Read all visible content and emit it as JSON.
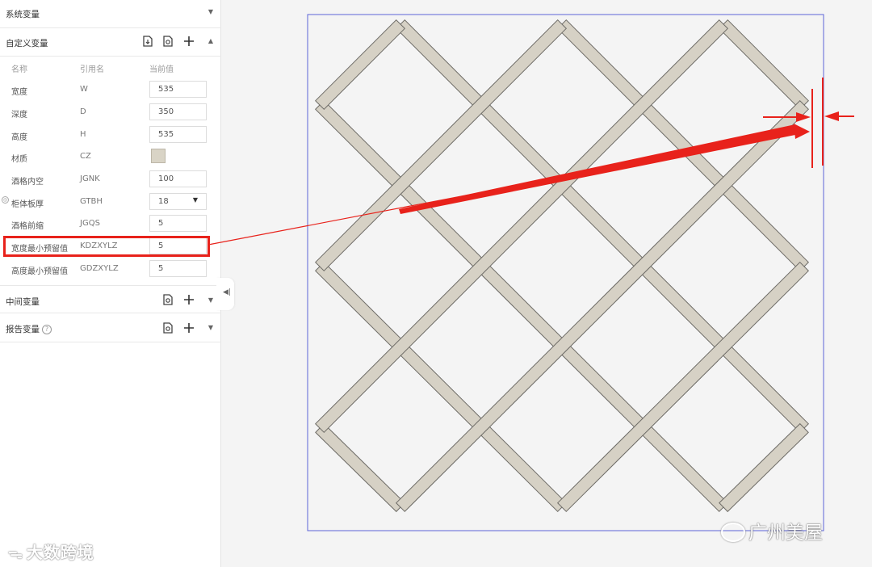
{
  "panel": {
    "system_section": {
      "title": "系统变量"
    },
    "custom_section": {
      "title": "自定义变量",
      "columns": {
        "name": "名称",
        "ref": "引用名",
        "value": "当前值"
      },
      "rows": [
        {
          "name": "宽度",
          "ref": "W",
          "value": "535"
        },
        {
          "name": "深度",
          "ref": "D",
          "value": "350"
        },
        {
          "name": "高度",
          "ref": "H",
          "value": "535"
        },
        {
          "name": "材质",
          "ref": "CZ",
          "swatch": "#d9d4c6"
        },
        {
          "name": "酒格内空",
          "ref": "JGNK",
          "value": "100"
        },
        {
          "name": "柜体板厚",
          "ref": "GTBH",
          "value": "18",
          "dropdown": true
        },
        {
          "name": "酒格前缩",
          "ref": "JGQS",
          "value": "5"
        },
        {
          "name": "宽度最小预留值",
          "ref": "KDZXYLZ",
          "value": "5"
        },
        {
          "name": "高度最小预留值",
          "ref": "GDZXYLZ",
          "value": "5"
        }
      ]
    },
    "middle_section": {
      "title": "中间变量"
    },
    "report_section": {
      "title": "报告变量",
      "help": "?"
    }
  },
  "colors": {
    "highlight": "#e8221b",
    "frame": "#5b63d9",
    "slat": "#d6d1c5",
    "slat_edge": "#6d6b66",
    "canvas": "#f4f4f4"
  },
  "watermarks": {
    "left": "大数跨境",
    "right": "广州美屋"
  }
}
